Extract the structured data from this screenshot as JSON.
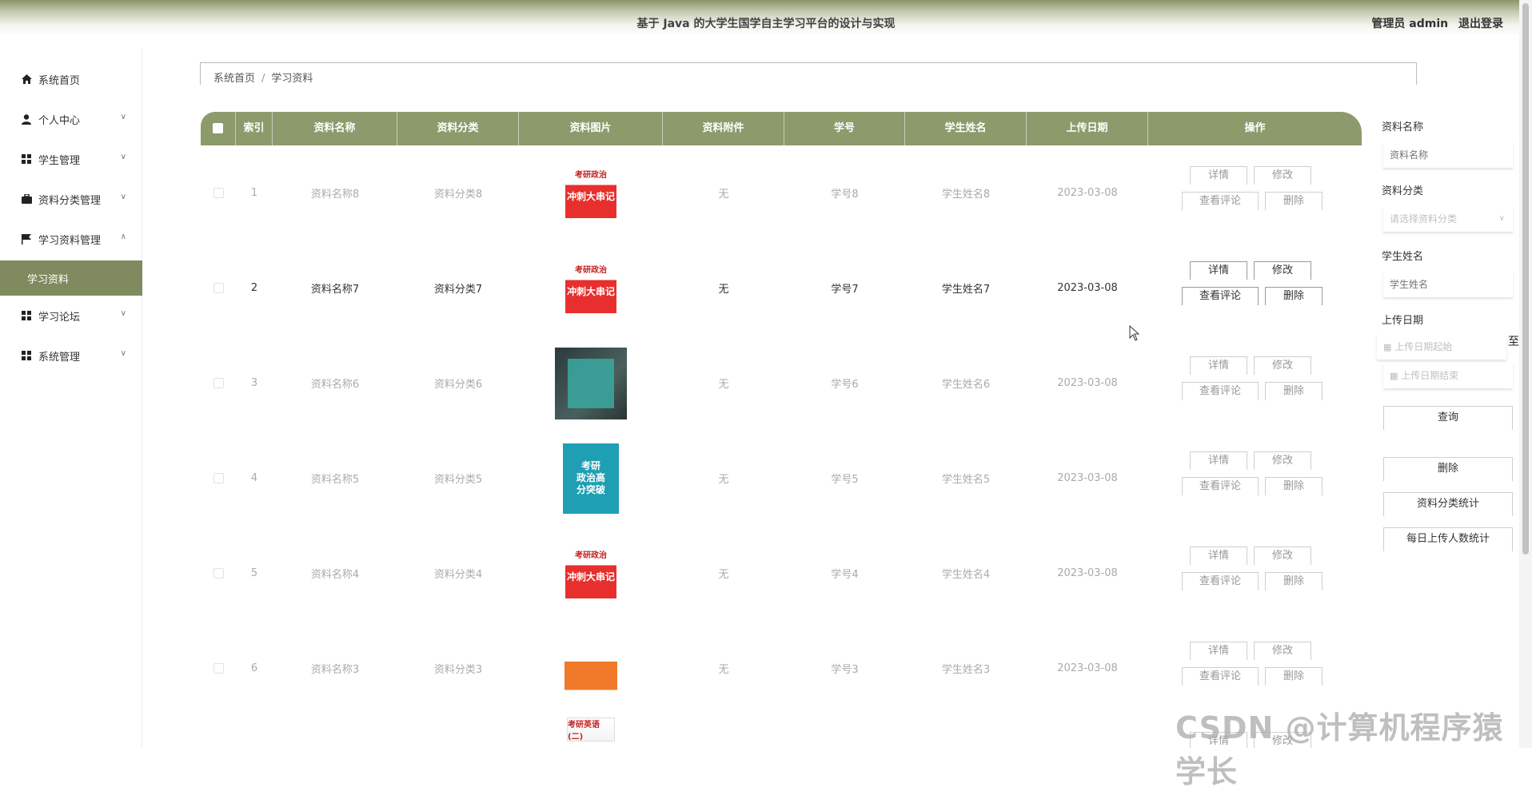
{
  "header": {
    "title": "基于 Java 的大学生国学自主学习平台的设计与实现",
    "user_label": "管理员 admin",
    "logout_label": "退出登录"
  },
  "sidebar": {
    "items": [
      {
        "label": "系统首页",
        "icon": "home-icon"
      },
      {
        "label": "个人中心",
        "icon": "user-icon"
      },
      {
        "label": "学生管理",
        "icon": "grid-icon"
      },
      {
        "label": "资料分类管理",
        "icon": "briefcase-icon"
      },
      {
        "label": "学习资料管理",
        "icon": "flag-icon"
      },
      {
        "label": "学习资料",
        "icon": ""
      },
      {
        "label": "学习论坛",
        "icon": "grid-icon"
      },
      {
        "label": "系统管理",
        "icon": "grid-icon"
      }
    ],
    "active_color": "#7f8a5e"
  },
  "breadcrumb": {
    "home": "系统首页",
    "current": "学习资料"
  },
  "table": {
    "header_color": "#8d9a6b",
    "columns": [
      "索引",
      "资料名称",
      "资料分类",
      "资料图片",
      "资料附件",
      "学号",
      "学生姓名",
      "上传日期",
      "操作"
    ],
    "rows": [
      {
        "index": "1",
        "name": "资料名称8",
        "category": "资料分类8",
        "image": "red-book-cover",
        "image_text": "考研政治",
        "image_title": "冲刺大串记",
        "attachment": "无",
        "student_no": "学号8",
        "student_name": "学生姓名8",
        "date": "2023-03-08"
      },
      {
        "index": "2",
        "name": "资料名称7",
        "category": "资料分类7",
        "image": "red-book-cover",
        "image_text": "考研政治",
        "image_title": "冲刺大串记",
        "attachment": "无",
        "student_no": "学号7",
        "student_name": "学生姓名7",
        "date": "2023-03-08"
      },
      {
        "index": "3",
        "name": "资料名称6",
        "category": "资料分类6",
        "image": "dark-book-photo",
        "attachment": "无",
        "student_no": "学号6",
        "student_name": "学生姓名6",
        "date": "2023-03-08"
      },
      {
        "index": "4",
        "name": "资料名称5",
        "category": "资料分类5",
        "image": "teal-book-cover",
        "image_text": "考研",
        "image_title": "政治高分突破",
        "attachment": "无",
        "student_no": "学号5",
        "student_name": "学生姓名5",
        "date": "2023-03-08"
      },
      {
        "index": "5",
        "name": "资料名称4",
        "category": "资料分类4",
        "image": "red-book-cover",
        "image_text": "考研政治",
        "image_title": "冲刺大串记",
        "attachment": "无",
        "student_no": "学号4",
        "student_name": "学生姓名4",
        "date": "2023-03-08"
      },
      {
        "index": "6",
        "name": "资料名称3",
        "category": "资料分类3",
        "image": "orange-book-cover",
        "attachment": "无",
        "student_no": "学号3",
        "student_name": "学生姓名3",
        "date": "2023-03-08"
      }
    ],
    "partial_row": {
      "image_text": "考研英语(二)"
    },
    "actions": {
      "detail": "详情",
      "edit": "修改",
      "comments": "查看评论",
      "delete": "删除"
    }
  },
  "search_panel": {
    "name_label": "资料名称",
    "name_placeholder": "资料名称",
    "category_label": "资料分类",
    "category_placeholder": "请选择资料分类",
    "student_label": "学生姓名",
    "student_placeholder": "学生姓名",
    "date_label": "上传日期",
    "date_start_placeholder": "上传日期起始",
    "date_end_placeholder": "上传日期结束",
    "date_separator": "至",
    "query_button": "查询",
    "delete_button": "删除",
    "category_stats_button": "资料分类统计",
    "daily_stats_button": "每日上传人数统计"
  },
  "watermark": "CSDN @计算机程序猿学长"
}
